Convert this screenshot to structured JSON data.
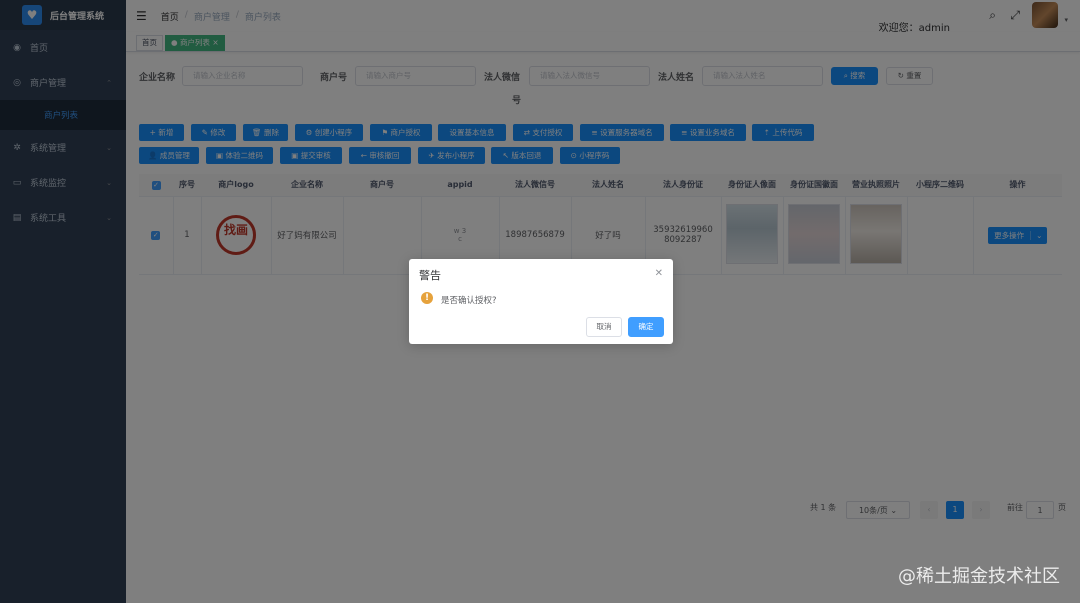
{
  "app": {
    "title": "后台管理系统"
  },
  "sidebar": {
    "items": [
      {
        "label": "首页",
        "icon": "dashboard-icon"
      },
      {
        "label": "商户管理",
        "icon": "merchant-icon",
        "expanded": true
      },
      {
        "label": "商户列表",
        "sub": true
      },
      {
        "label": "系统管理",
        "icon": "gear-icon"
      },
      {
        "label": "系统监控",
        "icon": "monitor-icon"
      },
      {
        "label": "系统工具",
        "icon": "tool-icon"
      }
    ]
  },
  "header": {
    "breadcrumb": [
      "首页",
      "商户管理",
      "商户列表"
    ],
    "welcome": "欢迎您：admin"
  },
  "tags": {
    "home": "首页",
    "current": "商户列表"
  },
  "search": {
    "company_label": "企业名称",
    "company_placeholder": "请输入企业名称",
    "merchant_no_label": "商户号",
    "merchant_no_placeholder": "请输入商户号",
    "legal_wechat_label": "法人微信",
    "legal_wechat_label_2": "号",
    "legal_wechat_placeholder": "请输入法人微信号",
    "legal_name_label": "法人姓名",
    "legal_name_placeholder": "请输入法人姓名",
    "search_button": "搜索",
    "reset_button": "重置"
  },
  "toolbar": {
    "row1": [
      "+ 新增",
      "修改",
      "删除",
      "创建小程序",
      "商户授权",
      "设置基本信息",
      "支付授权",
      "设置服务器域名",
      "设置业务域名",
      "上传代码"
    ],
    "row2": [
      "成员管理",
      "体验二维码",
      "提交审核",
      "审核撤回",
      "发布小程序",
      "版本回退",
      "小程序码"
    ]
  },
  "table": {
    "headers": [
      "序号",
      "商户logo",
      "企业名称",
      "商户号",
      "appid",
      "法人微信号",
      "法人姓名",
      "法人身份证",
      "身份证人像面",
      "身份证国徽面",
      "营业执照照片",
      "小程序二维码",
      "操作"
    ],
    "rows": [
      {
        "index": "1",
        "logo_text": "找画",
        "company": "好了妈有限公司",
        "merchant_no": "",
        "appid_1": "w 3",
        "appid_2": "c",
        "legal_wechat": "18987656879",
        "legal_name": "好了吗",
        "id_card_1": "35932619960",
        "id_card_2": "8092287",
        "action": "更多操作"
      }
    ]
  },
  "pagination": {
    "total": "共 1 条",
    "page_size": "10条/页",
    "current_page": "1",
    "goto_label": "前往",
    "goto_value": "1",
    "page_suffix": "页"
  },
  "dialog": {
    "title": "警告",
    "message": "是否确认授权?",
    "cancel": "取消",
    "confirm": "确定"
  },
  "watermark": "@稀土掘金技术社区",
  "colors": {
    "primary": "#1890ff",
    "sidebar": "#304156",
    "tag_active": "#42b983",
    "warning": "#e6a23c"
  }
}
